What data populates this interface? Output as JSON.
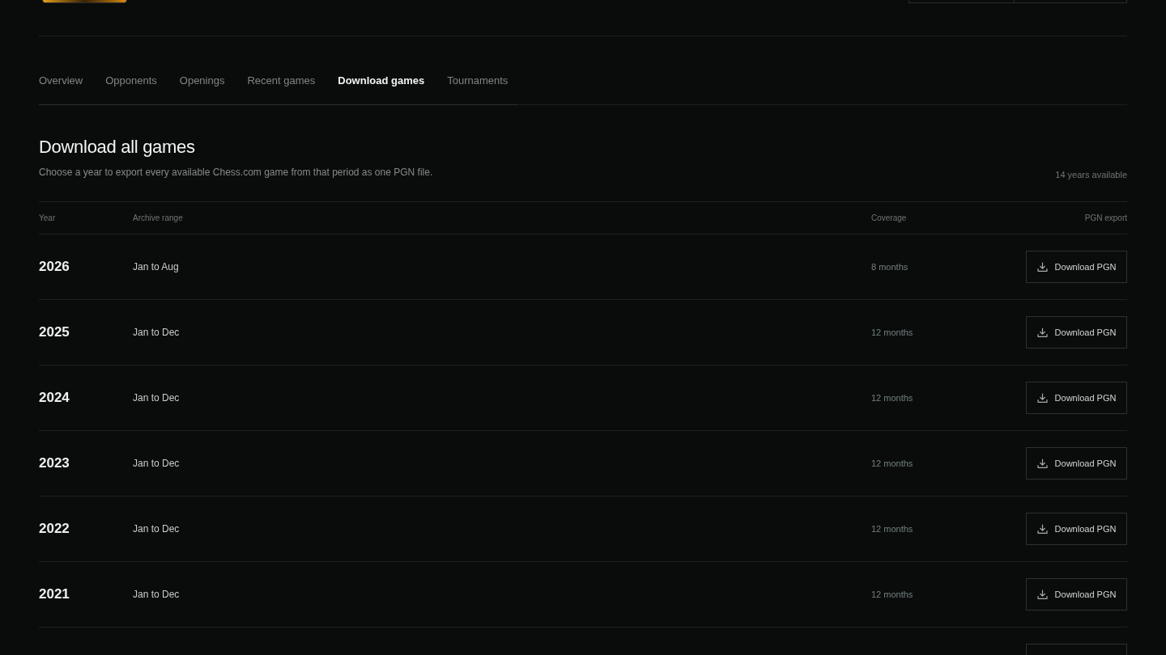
{
  "tabs": [
    {
      "label": "Overview",
      "selected": false
    },
    {
      "label": "Opponents",
      "selected": false
    },
    {
      "label": "Openings",
      "selected": false
    },
    {
      "label": "Recent games",
      "selected": false
    },
    {
      "label": "Download games",
      "selected": true
    },
    {
      "label": "Tournaments",
      "selected": false
    }
  ],
  "section": {
    "title": "Download all games",
    "description": "Choose a year to export every available Chess.com game from that period as one PGN file.",
    "summary": "14 years available"
  },
  "table": {
    "columns": [
      "Year",
      "Archive range",
      "Coverage",
      "PGN export"
    ],
    "rows": [
      {
        "year": "2026",
        "range": "Jan to Aug",
        "coverage": "8 months",
        "button": "Download PGN"
      },
      {
        "year": "2025",
        "range": "Jan to Dec",
        "coverage": "12 months",
        "button": "Download PGN"
      },
      {
        "year": "2024",
        "range": "Jan to Dec",
        "coverage": "12 months",
        "button": "Download PGN"
      },
      {
        "year": "2023",
        "range": "Jan to Dec",
        "coverage": "12 months",
        "button": "Download PGN"
      },
      {
        "year": "2022",
        "range": "Jan to Dec",
        "coverage": "12 months",
        "button": "Download PGN"
      },
      {
        "year": "2021",
        "range": "Jan to Dec",
        "coverage": "12 months",
        "button": "Download PGN"
      }
    ],
    "more_rows_below": true
  }
}
